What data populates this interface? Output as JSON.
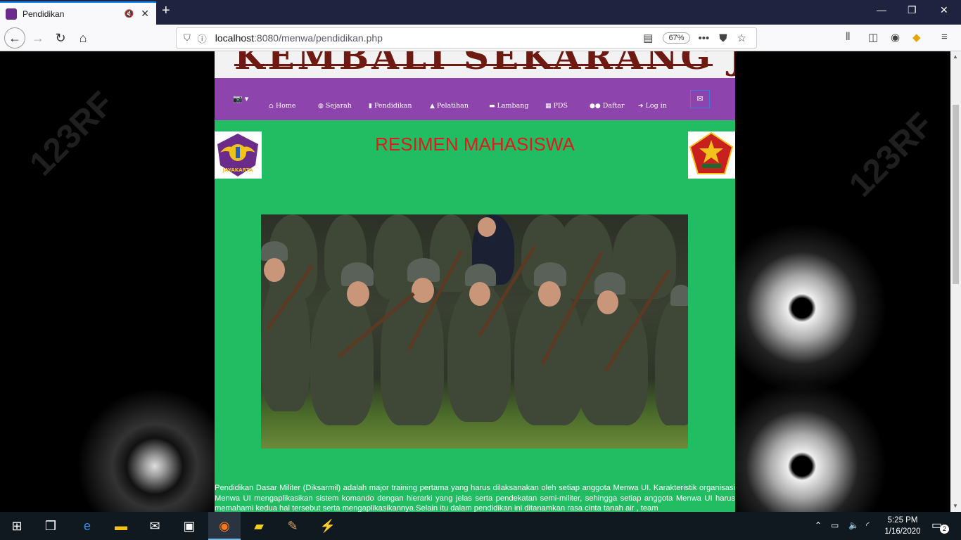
{
  "browser": {
    "tab_title": "Pendidikan",
    "url_host": "localhost",
    "url_rest": ":8080/menwa/pendidikan.php",
    "zoom": "67%"
  },
  "site": {
    "banner_text": "KEMBALI SEKARANG JUGA",
    "nav": {
      "home": "Home",
      "sejarah": "Sejarah",
      "pendidikan": "Pendidikan",
      "pelatihan": "Pelatihan",
      "lambang": "Lambang",
      "pds": "PDS",
      "daftar": "Daftar",
      "login": "Log in"
    },
    "title": "RESIMEN MAHASISWA",
    "logo_left_text": "JAYAKARTA",
    "article": "Pendidikan Dasar Militer (Diksarmil) adalah major training pertama yang harus dilaksanakan oleh setiap anggota Menwa UI. Karakteristik organisasi Menwa UI mengaplikasikan sistem komando dengan hierarki yang jelas serta pendekatan semi-militer, sehingga setiap anggota Menwa UI harus memahami kedua hal tersebut serta mengaplikasikannya.Selain itu dalam pendidikan ini ditanamkan rasa cinta tanah air , team"
  },
  "taskbar": {
    "time": "5:25 PM",
    "date": "1/16/2020",
    "notifications": "2"
  },
  "colors": {
    "content_bg": "#22bc62",
    "nav_bg": "#8e44ad",
    "title": "#e01b1b"
  }
}
